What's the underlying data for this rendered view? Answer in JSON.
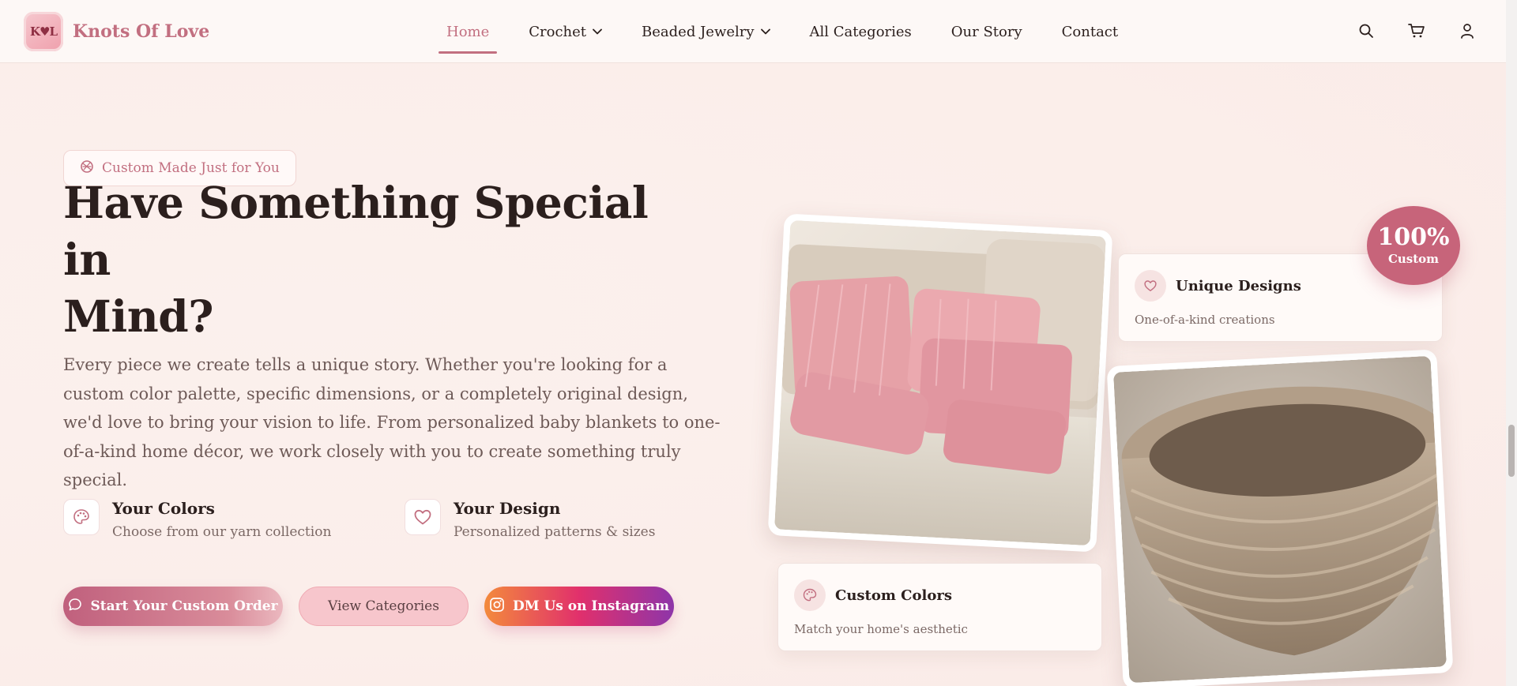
{
  "brand": {
    "mark": "K♥L",
    "name": "Knots Of Love"
  },
  "nav": {
    "items": [
      {
        "label": "Home",
        "active": true
      },
      {
        "label": "Crochet",
        "dropdown": true
      },
      {
        "label": "Beaded Jewelry",
        "dropdown": true
      },
      {
        "label": "All Categories"
      },
      {
        "label": "Our Story"
      },
      {
        "label": "Contact"
      }
    ],
    "icons": [
      "search-icon",
      "cart-icon",
      "user-icon"
    ]
  },
  "hero": {
    "badge": "Custom Made Just for You",
    "headline_line1": "Have Something Special in",
    "headline_line2": "Mind?",
    "lede": "Every piece we create tells a unique story. Whether you're looking for a custom color palette, specific dimensions, or a completely original design, we'd love to bring your vision to life. From personalized baby blankets to one-of-a-kind home décor, we work closely with you to create something truly special.",
    "features": [
      {
        "title": "Your Colors",
        "sub": "Choose from our yarn collection",
        "icon": "palette-icon"
      },
      {
        "title": "Your Design",
        "sub": "Personalized patterns & sizes",
        "icon": "heart-icon"
      }
    ],
    "buttons": {
      "primary": "Start Your Custom Order",
      "secondary": "View Categories",
      "instagram": "DM Us on Instagram"
    }
  },
  "collage": {
    "card_unique": {
      "title": "Unique Designs",
      "sub": "One-of-a-kind creations"
    },
    "card_colors": {
      "title": "Custom Colors",
      "sub": "Match your home's aesthetic"
    },
    "circle": {
      "big": "100%",
      "small": "Custom"
    }
  },
  "colors": {
    "accent": "#c26f80",
    "badge": "#c7647a",
    "bg": "#fbeeea"
  }
}
